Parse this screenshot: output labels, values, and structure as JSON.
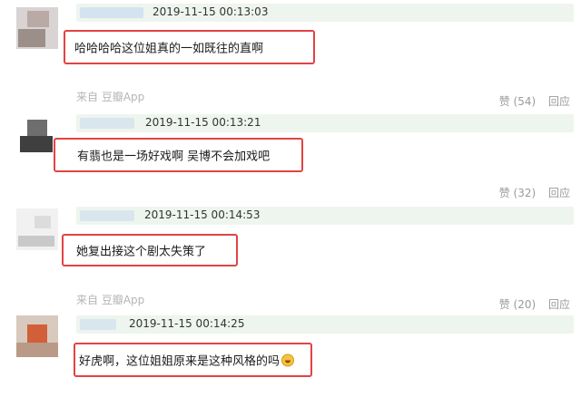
{
  "comments": [
    {
      "timestamp": "2019-11-15 00:13:03",
      "text": "哈哈哈哈这位姐真的一如既往的直啊",
      "source": "来自 豆瓣App",
      "likes_label": "赞 (54)",
      "reply_label": "回应"
    },
    {
      "timestamp": "2019-11-15 00:13:21",
      "text": "有翡也是一场好戏啊 吴博不会加戏吧",
      "source": "",
      "likes_label": "赞 (32)",
      "reply_label": "回应"
    },
    {
      "timestamp": "2019-11-15 00:14:53",
      "text": "她复出接这个剧太失策了",
      "source": "来自 豆瓣App",
      "likes_label": "赞 (20)",
      "reply_label": "回应"
    },
    {
      "timestamp": "2019-11-15 00:14:25",
      "text": "好虎啊，这位姐姐原来是这种风格的吗",
      "emoji": "grinning-face-emoji"
    }
  ],
  "colors": {
    "highlight_border": "#e24343",
    "header_bg": "#eef5ee",
    "meta_text": "#b5b5b5",
    "action_text": "#9a9a9a"
  }
}
